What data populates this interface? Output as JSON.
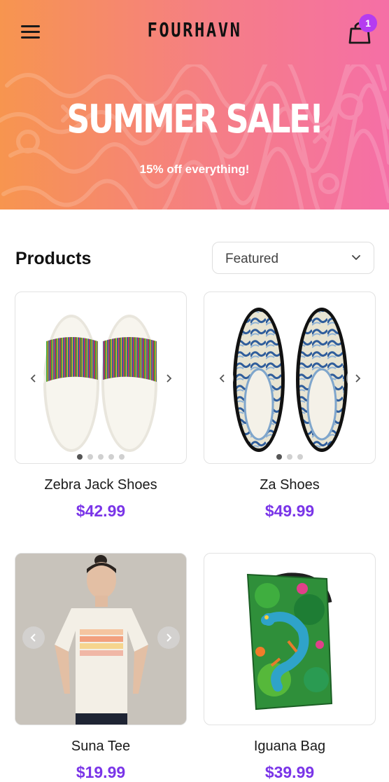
{
  "header": {
    "brand": "FOURHAVN",
    "cart_count": "1"
  },
  "hero": {
    "title": "SUMMER SALE!",
    "subtitle": "15% off everything!"
  },
  "products_section": {
    "title": "Products",
    "sort_selected": "Featured"
  },
  "products": [
    {
      "name": "Zebra Jack Shoes",
      "price": "$42.99",
      "image_count": 5,
      "active_image": 1
    },
    {
      "name": "Za Shoes",
      "price": "$49.99",
      "image_count": 3,
      "active_image": 1
    },
    {
      "name": "Suna Tee",
      "price": "$19.99"
    },
    {
      "name": "Iguana Bag",
      "price": "$39.99"
    }
  ],
  "colors": {
    "gradient_start": "#f7954f",
    "gradient_end": "#f56fa6",
    "price": "#7a35e8",
    "badge": "#b53cf0"
  }
}
